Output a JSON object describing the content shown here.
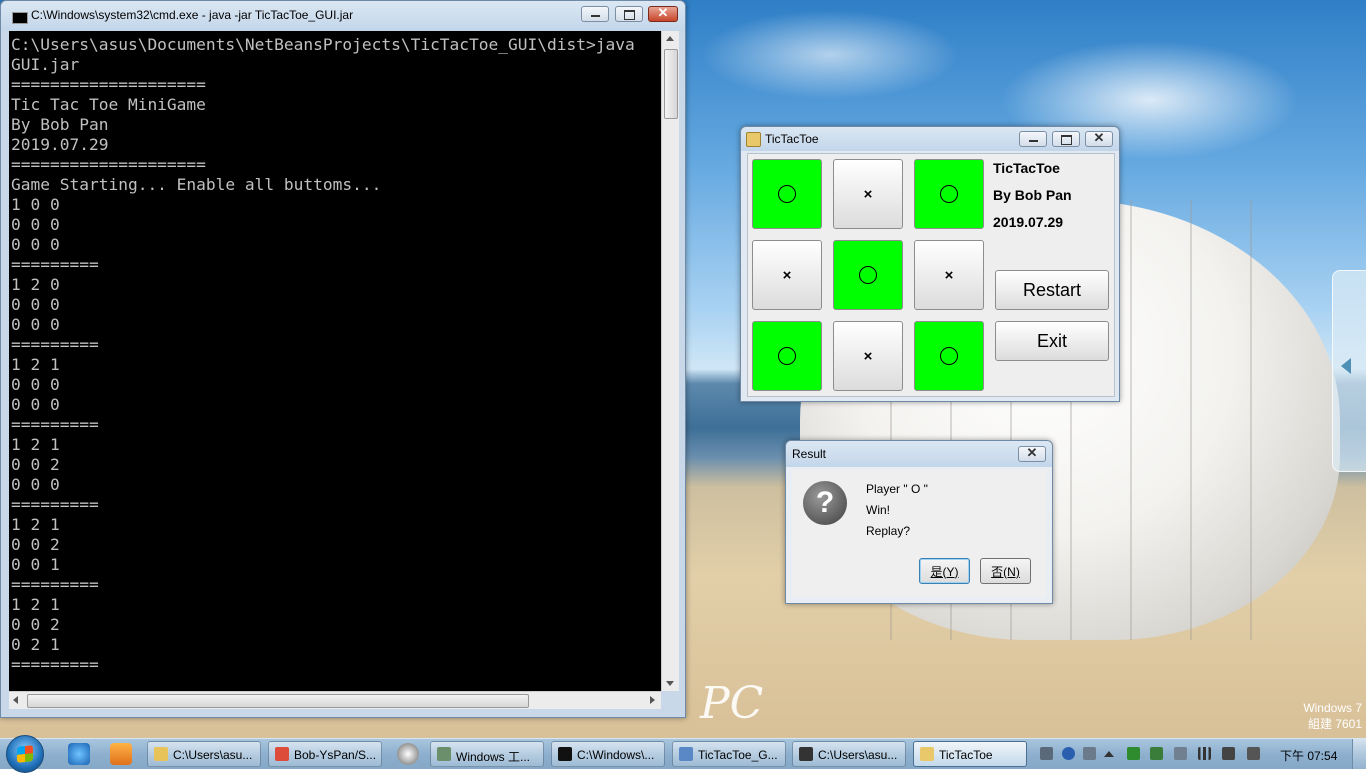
{
  "cmd": {
    "title": "C:\\Windows\\system32\\cmd.exe - java  -jar TicTacToe_GUI.jar",
    "lines": [
      "C:\\Users\\asus\\Documents\\NetBeansProjects\\TicTacToe_GUI\\dist>java",
      "GUI.jar",
      "====================",
      "Tic Tac Toe MiniGame",
      "By Bob Pan",
      "2019.07.29",
      "====================",
      "Game Starting... Enable all buttoms...",
      "1 0 0",
      "0 0 0",
      "0 0 0",
      "=========",
      "1 2 0",
      "0 0 0",
      "0 0 0",
      "=========",
      "1 2 1",
      "0 0 0",
      "0 0 0",
      "=========",
      "1 2 1",
      "0 0 2",
      "0 0 0",
      "=========",
      "1 2 1",
      "0 0 2",
      "0 0 1",
      "=========",
      "1 2 1",
      "0 0 2",
      "0 2 1",
      "========="
    ]
  },
  "ttt": {
    "title": "TicTacToe",
    "board": [
      "O",
      "×",
      "O",
      "×",
      "O",
      "×",
      "O",
      "×",
      "O"
    ],
    "info_title": "TicTacToe",
    "info_author": "By Bob Pan",
    "info_date": "2019.07.29",
    "restart_label": "Restart",
    "exit_label": "Exit",
    "o_color": "#00ff00"
  },
  "result": {
    "title": "Result",
    "icon": "question-icon",
    "line1": "Player \" O \"",
    "line2": "Win!",
    "line3": "Replay?",
    "yes_label": "是(Y)",
    "no_label": "否(N)"
  },
  "desktop": {
    "watermark": "PC",
    "build_line1": "Windows 7",
    "build_line2": "組建 7601"
  },
  "taskbar": {
    "tasks": [
      {
        "label": "C:\\Users\\asu...",
        "icon": "folder-icon",
        "active": false
      },
      {
        "label": "Bob-YsPan/S...",
        "icon": "chrome-icon",
        "active": false
      },
      {
        "label": "Windows 工...",
        "icon": "tool-icon",
        "active": false
      },
      {
        "label": "C:\\Windows\\...",
        "icon": "cmd-icon",
        "active": false
      },
      {
        "label": "TicTacToe_G...",
        "icon": "netbeans-icon",
        "active": false
      },
      {
        "label": "C:\\Users\\asu...",
        "icon": "7zip-icon",
        "active": false
      },
      {
        "label": "TicTacToe",
        "icon": "java-icon",
        "active": true
      }
    ],
    "clock": "下午 07:54"
  }
}
